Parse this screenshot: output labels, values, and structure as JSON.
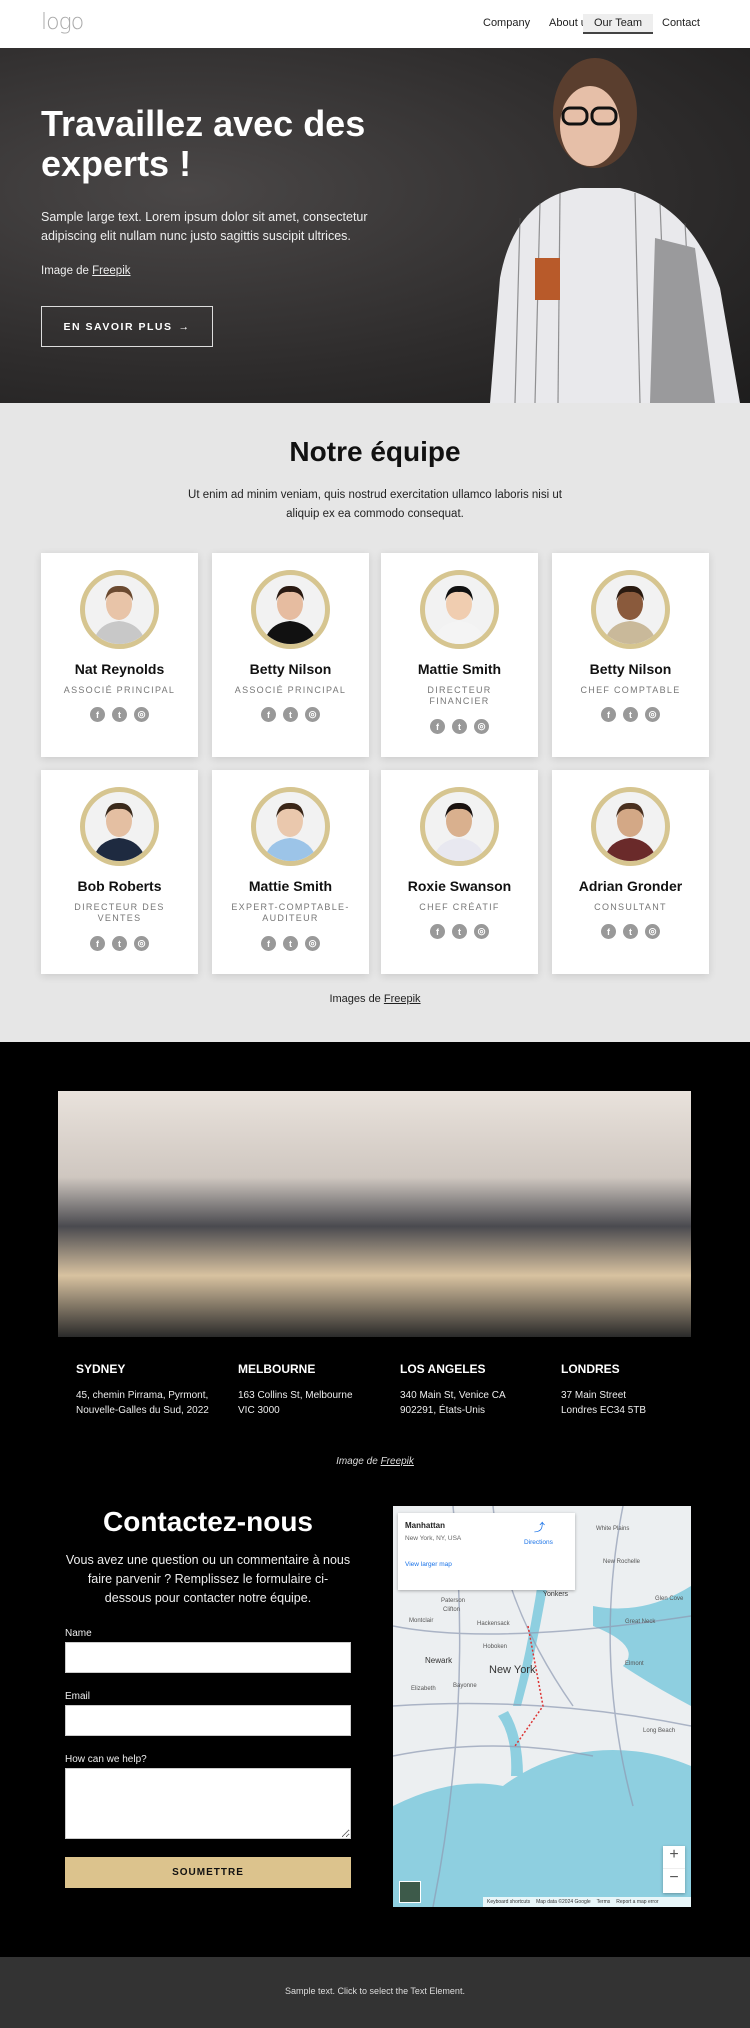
{
  "nav": {
    "logo": "logo",
    "items": [
      {
        "label": "Company"
      },
      {
        "label": "About us"
      },
      {
        "label": "Our Team",
        "active": true
      },
      {
        "label": "Contact"
      }
    ]
  },
  "hero": {
    "title": "Travaillez avec des experts !",
    "text": "Sample large text. Lorem ipsum dolor sit amet, consectetur adipiscing elit nullam nunc justo sagittis suscipit ultrices.",
    "credit_prefix": "Image de",
    "credit_link": "Freepik",
    "button": "EN SAVOIR PLUS",
    "button_icon": "arrow-right-icon"
  },
  "team": {
    "title": "Notre équipe",
    "text": "Ut enim ad minim veniam, quis nostrud exercitation ullamco laboris nisi ut aliquip ex ea commodo consequat.",
    "members": [
      {
        "name": "Nat Reynolds",
        "role": "ASSOCIÉ PRINCIPAL"
      },
      {
        "name": "Betty Nilson",
        "role": "ASSOCIÉ PRINCIPAL"
      },
      {
        "name": "Mattie Smith",
        "role": "DIRECTEUR FINANCIER"
      },
      {
        "name": "Betty Nilson",
        "role": "CHEF COMPTABLE"
      },
      {
        "name": "Bob Roberts",
        "role": "DIRECTEUR DES VENTES"
      },
      {
        "name": "Mattie Smith",
        "role": "EXPERT-COMPTABLE-AUDITEUR"
      },
      {
        "name": "Roxie Swanson",
        "role": "CHEF CRÉATIF"
      },
      {
        "name": "Adrian Gronder",
        "role": "CONSULTANT"
      }
    ],
    "social_icons": [
      "facebook-icon",
      "twitter-icon",
      "instagram-icon"
    ],
    "credit_prefix": "Images de",
    "credit_link": "Freepik",
    "accent": "#d6c590"
  },
  "offices": {
    "cities": [
      {
        "name": "SYDNEY",
        "address": "45, chemin Pirrama, Pyrmont, Nouvelle-Galles du Sud, 2022"
      },
      {
        "name": "MELBOURNE",
        "address": "163 Collins St, Melbourne VIC 3000"
      },
      {
        "name": "LOS ANGELES",
        "address": "340 Main St, Venice CA 902291, États-Unis"
      },
      {
        "name": "LONDRES",
        "address": "37 Main Street Londres EC34 5TB"
      }
    ],
    "credit_prefix": "Image de",
    "credit_link": "Freepik"
  },
  "contact": {
    "title": "Contactez-nous",
    "text": "Vous avez une question ou un commentaire à nous faire parvenir ? Remplissez le formulaire ci-dessous pour contacter notre équipe.",
    "name_label": "Name",
    "name_value": "",
    "email_label": "Email",
    "email_value": "",
    "help_label": "How can we help?",
    "help_value": "",
    "submit": "SOUMETTRE",
    "submit_color": "#dcc38d"
  },
  "map": {
    "place": "Manhattan",
    "address": "New York, NY, USA",
    "directions": "Directions",
    "larger": "View larger map",
    "city_label": "New York",
    "labels": [
      "Yonkers",
      "Paterson",
      "Hackensack",
      "Newark",
      "Elizabeth",
      "Bayonne",
      "Hoboken",
      "Long Beach",
      "Glen Cove",
      "Great Neck",
      "Elmont",
      "Clifton",
      "Montclair",
      "White Plains",
      "New Rochelle"
    ],
    "attribution": [
      "Keyboard shortcuts",
      "Map data ©2024 Google",
      "Terms",
      "Report a map error"
    ]
  },
  "footer": {
    "text": "Sample text. Click to select the Text Element."
  }
}
